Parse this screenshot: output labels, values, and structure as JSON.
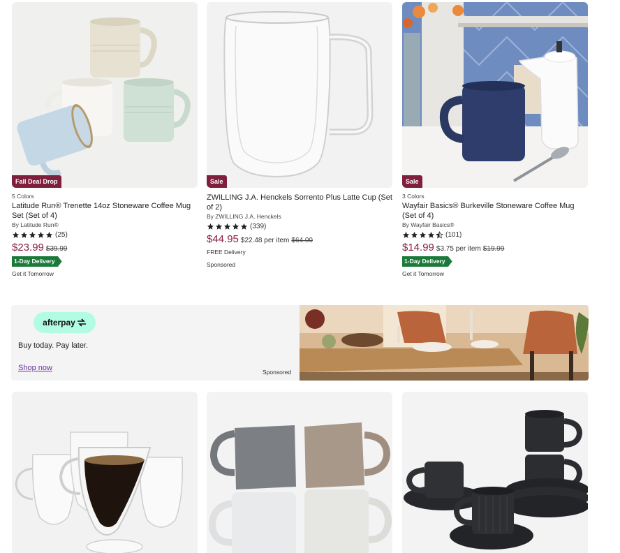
{
  "products": [
    {
      "badge": "Fall Deal Drop",
      "colors": "5 Colors",
      "title": "Latitude Run® Trenette 14oz Stoneware Coffee Mug Set (Set of 4)",
      "brand": "By Latitude Run®",
      "rating": 5,
      "review_count": "(25)",
      "price": "$23.99",
      "per_item": "",
      "old_price": "$39.99",
      "delivery_badge": "1-Day Delivery",
      "note": "Get it Tomorrow"
    },
    {
      "badge": "Sale",
      "colors": "",
      "title": "ZWILLING J.A. Henckels Sorrento Plus Latte Cup (Set of 2)",
      "brand": "By ZWILLING J.A. Henckels",
      "rating": 5,
      "review_count": "(339)",
      "price": "$44.95",
      "per_item": "$22.48 per item",
      "old_price": "$64.00",
      "delivery_badge": "",
      "note": "FREE Delivery",
      "sponsored": "Sponsored"
    },
    {
      "badge": "Sale",
      "colors": "3 Colors",
      "title": "Wayfair Basics® Burkeville Stoneware Coffee Mug (Set of 4)",
      "brand": "By Wayfair Basics®",
      "rating": 4.5,
      "review_count": "(101)",
      "price": "$14.99",
      "per_item": "$3.75 per item",
      "old_price": "$19.99",
      "delivery_badge": "1-Day Delivery",
      "note": "Get it Tomorrow"
    }
  ],
  "banner": {
    "logo_text": "afterpay",
    "tagline": "Buy today. Pay later.",
    "link": "Shop now",
    "sponsored": "Sponsored"
  },
  "colors": {
    "price": "#8a1f46",
    "badge": "#7f1e3d",
    "delivery": "#1b7a3a",
    "afterpay_mint": "#b2fce4",
    "link": "#6a2ea0"
  }
}
